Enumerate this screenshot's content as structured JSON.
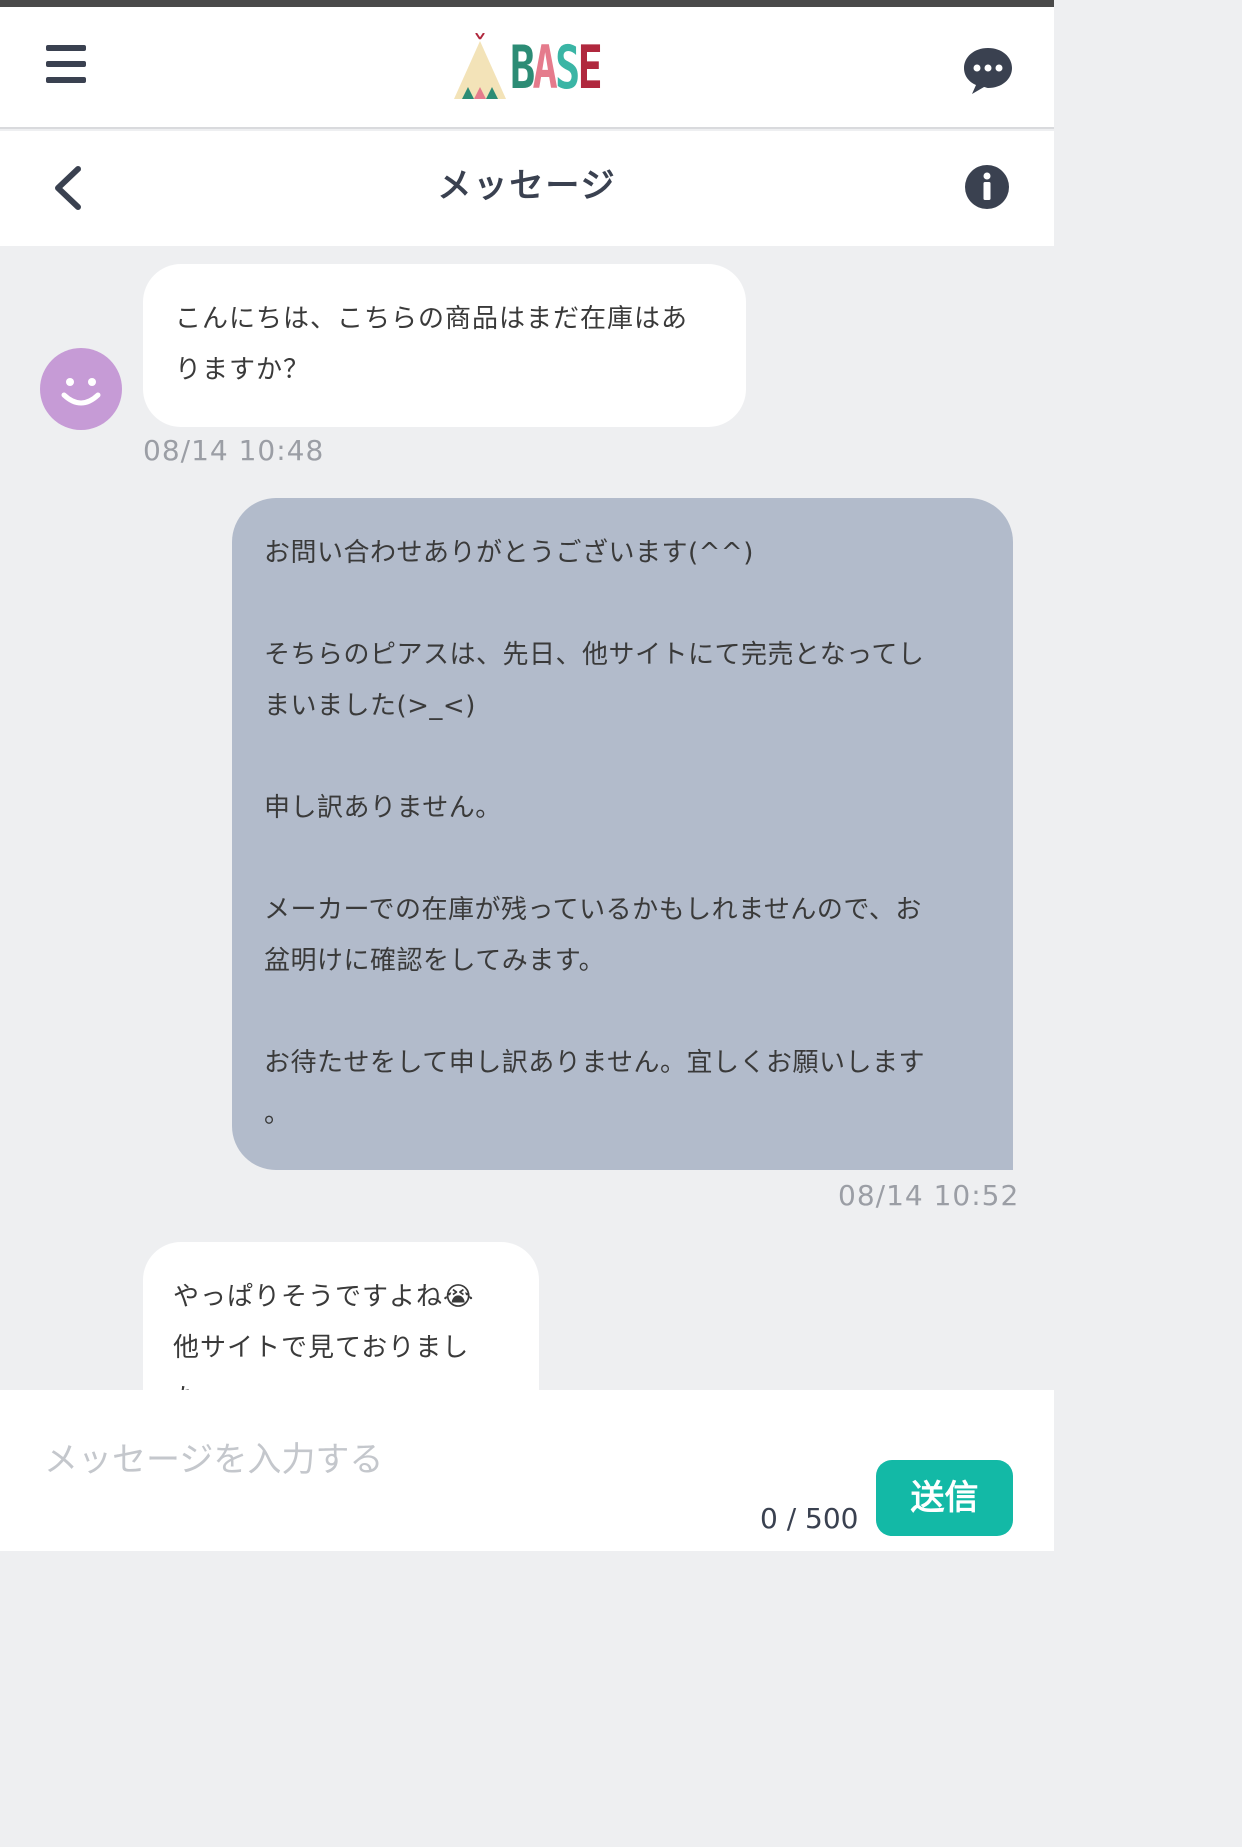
{
  "header": {
    "logo_text": "BASE",
    "logo_colors": [
      "#2c8c75",
      "#e57b8c",
      "#3ab5a5",
      "#b0283e"
    ]
  },
  "titlebar": {
    "title": "メッセージ"
  },
  "messages": [
    {
      "direction": "incoming",
      "lines": [
        "こんにちは、こちらの商品はまだ在庫はあ",
        "りますか？"
      ],
      "time": "08/14 10:48"
    },
    {
      "direction": "outgoing",
      "lines": [
        "お問い合わせありがとうございます(^^)",
        "",
        "そちらのピアスは、先日、他サイトにて完売となってし",
        "まいました(>_<)",
        "",
        "申し訳ありません。",
        "",
        "メーカーでの在庫が残っているかもしれませんので、お",
        "盆明けに確認をしてみます。",
        "",
        "お待たせをして申し訳ありません。宜しくお願いします",
        "。"
      ],
      "time": "08/14 10:52"
    },
    {
      "direction": "incoming",
      "lines": [
        "やっぱりそうですよね😭",
        "他サイトで見ておりまし",
        "た"
      ]
    }
  ],
  "composer": {
    "placeholder": "メッセージを入力する",
    "counter": "0 / 500",
    "send_label": "送信"
  },
  "colors": {
    "accent": "#13b9a6",
    "outgoing_bubble": "#b2bbcb",
    "avatar": "#c69bd6"
  }
}
